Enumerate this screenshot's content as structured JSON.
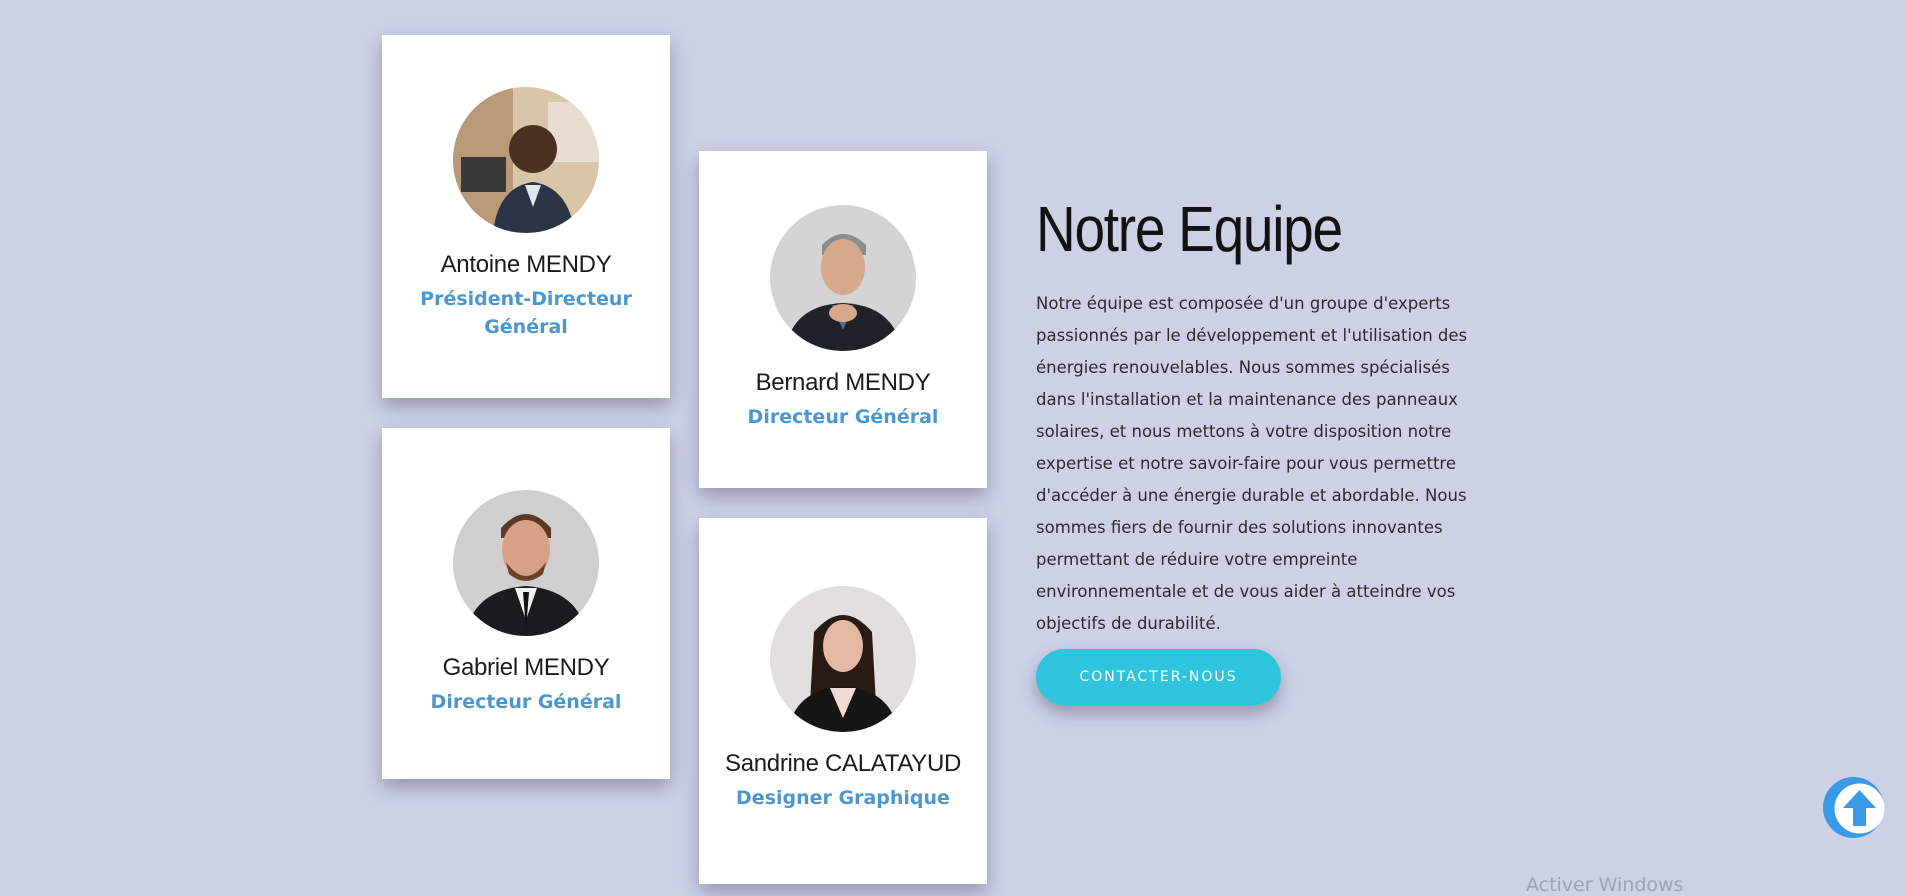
{
  "team": [
    {
      "name": "Antoine MENDY",
      "role": "Président-Directeur Général"
    },
    {
      "name": "Bernard MENDY",
      "role": "Directeur Général"
    },
    {
      "name": "Gabriel MENDY",
      "role": "Directeur Général"
    },
    {
      "name": "Sandrine CALATAYUD",
      "role": "Designer Graphique"
    }
  ],
  "intro": {
    "title": "Notre Equipe",
    "text": "Notre équipe est composée d'un groupe d'experts passionnés par le développement et l'utilisation des énergies renouvelables. Nous sommes spécialisés dans l'installation et la maintenance des panneaux solaires, et nous mettons à votre disposition notre expertise et notre savoir-faire pour vous permettre d'accéder à une énergie durable et abordable. Nous sommes fiers de fournir des solutions innovantes permettant de réduire votre empreinte environnementale et de vous aider à atteindre vos objectifs de durabilité.",
    "cta_label": "CONTACTER-NOUS"
  },
  "scroll_top": {
    "icon": "arrow-up-icon"
  },
  "watermark": "Activer Windows",
  "colors": {
    "background": "#cdd1e6",
    "accent": "#2fc4dd",
    "role": "#4b97cf",
    "scroll_button": "#3a9ae6"
  }
}
